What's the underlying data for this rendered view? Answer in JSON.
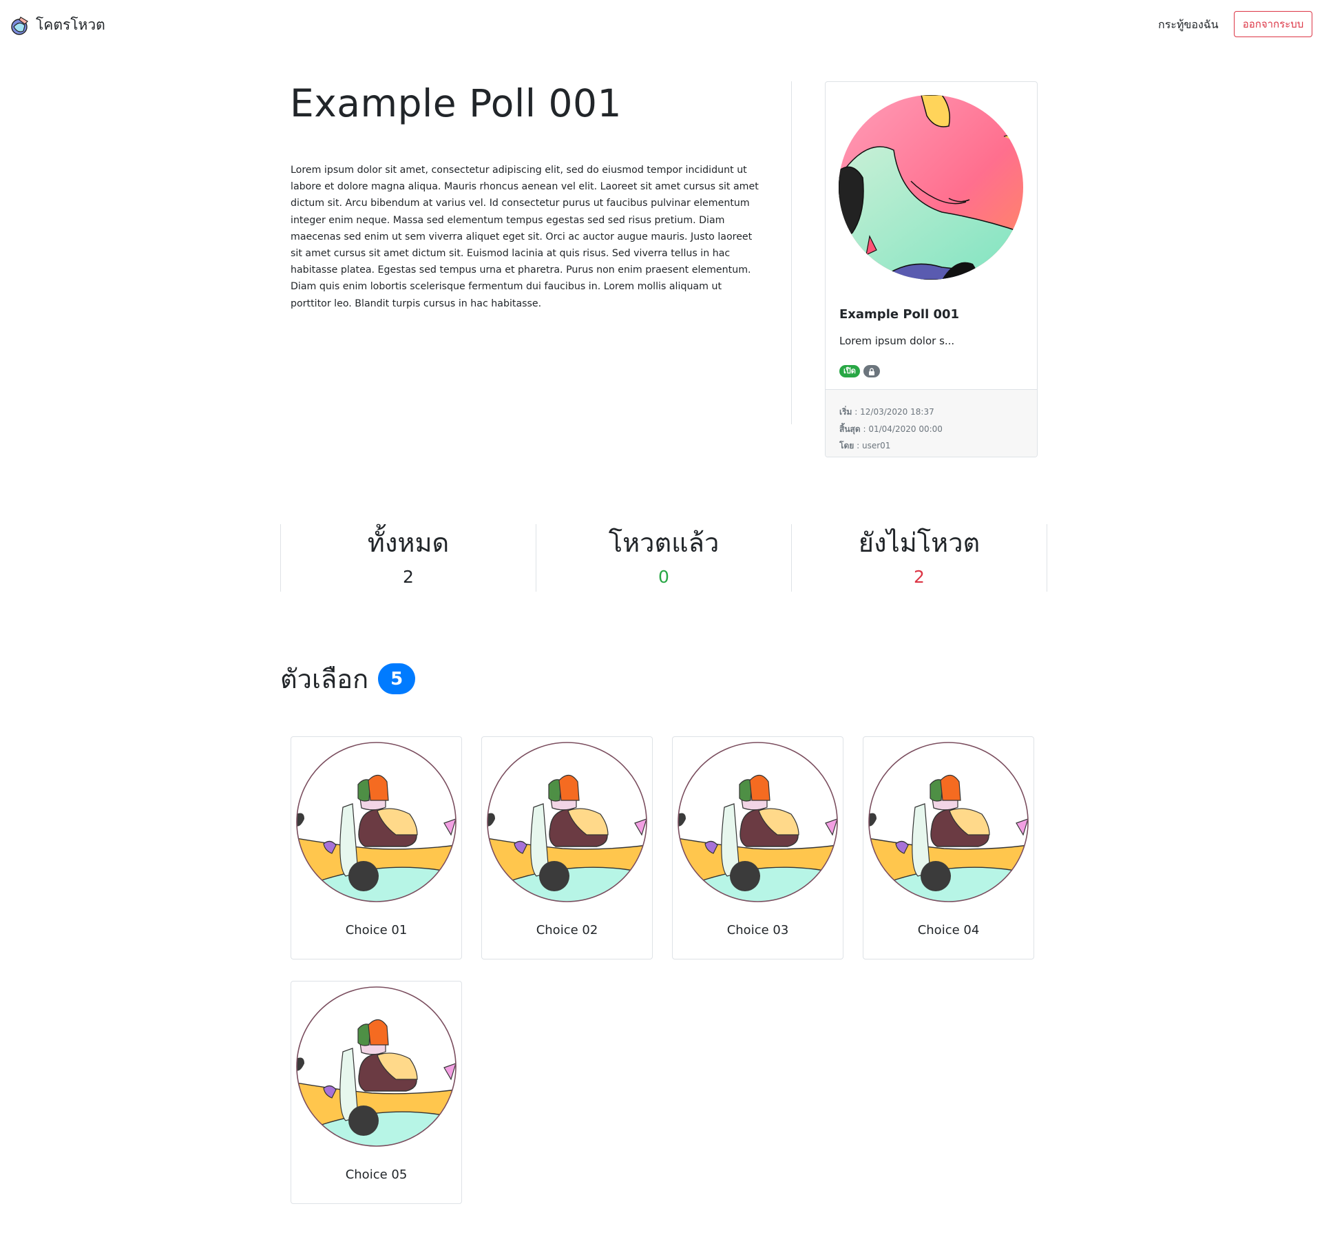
{
  "nav": {
    "brand": "โคตรโหวต",
    "my_polls": "กระทู้ของฉัน",
    "logout": "ออกจากระบบ"
  },
  "poll": {
    "title": "Example Poll 001",
    "description": "Lorem ipsum dolor sit amet, consectetur adipiscing elit, sed do eiusmod tempor incididunt ut labore et dolore magna aliqua. Mauris rhoncus aenean vel elit. Laoreet sit amet cursus sit amet dictum sit. Arcu bibendum at varius vel. Id consectetur purus ut faucibus pulvinar elementum integer enim neque. Massa sed elementum tempus egestas sed sed risus pretium. Diam maecenas sed enim ut sem viverra aliquet eget sit. Orci ac auctor augue mauris. Justo laoreet sit amet cursus sit amet dictum sit. Euismod lacinia at quis risus. Sed viverra tellus in hac habitasse platea. Egestas sed tempus urna et pharetra. Purus non enim praesent elementum. Diam quis enim lobortis scelerisque fermentum dui faucibus in. Lorem mollis aliquam ut porttitor leo. Blandit turpis cursus in hac habitasse."
  },
  "card": {
    "title": "Example Poll 001",
    "excerpt": "Lorem ipsum dolor s...",
    "status_badge": "เปิด",
    "lock_icon": "lock-icon",
    "start_label": "เริ่ม",
    "start_value": ": 12/03/2020 18:37",
    "end_label": "สิ้นสุด",
    "end_value": ": 01/04/2020 00:00",
    "by_label": "โดย",
    "by_value": ": user01"
  },
  "stats": {
    "total_label": "ทั้งหมด",
    "total_value": "2",
    "voted_label": "โหวตแล้ว",
    "voted_value": "0",
    "not_voted_label": "ยังไม่โหวต",
    "not_voted_value": "2"
  },
  "choices_section": {
    "title": "ตัวเลือก",
    "count": "5"
  },
  "choices": [
    {
      "label": "Choice 01"
    },
    {
      "label": "Choice 02"
    },
    {
      "label": "Choice 03"
    },
    {
      "label": "Choice 04"
    },
    {
      "label": "Choice 05"
    }
  ],
  "colors": {
    "primary": "#007bff",
    "success": "#28a745",
    "danger": "#dc3545",
    "secondary": "#6c757d",
    "border": "#dee2e6"
  }
}
